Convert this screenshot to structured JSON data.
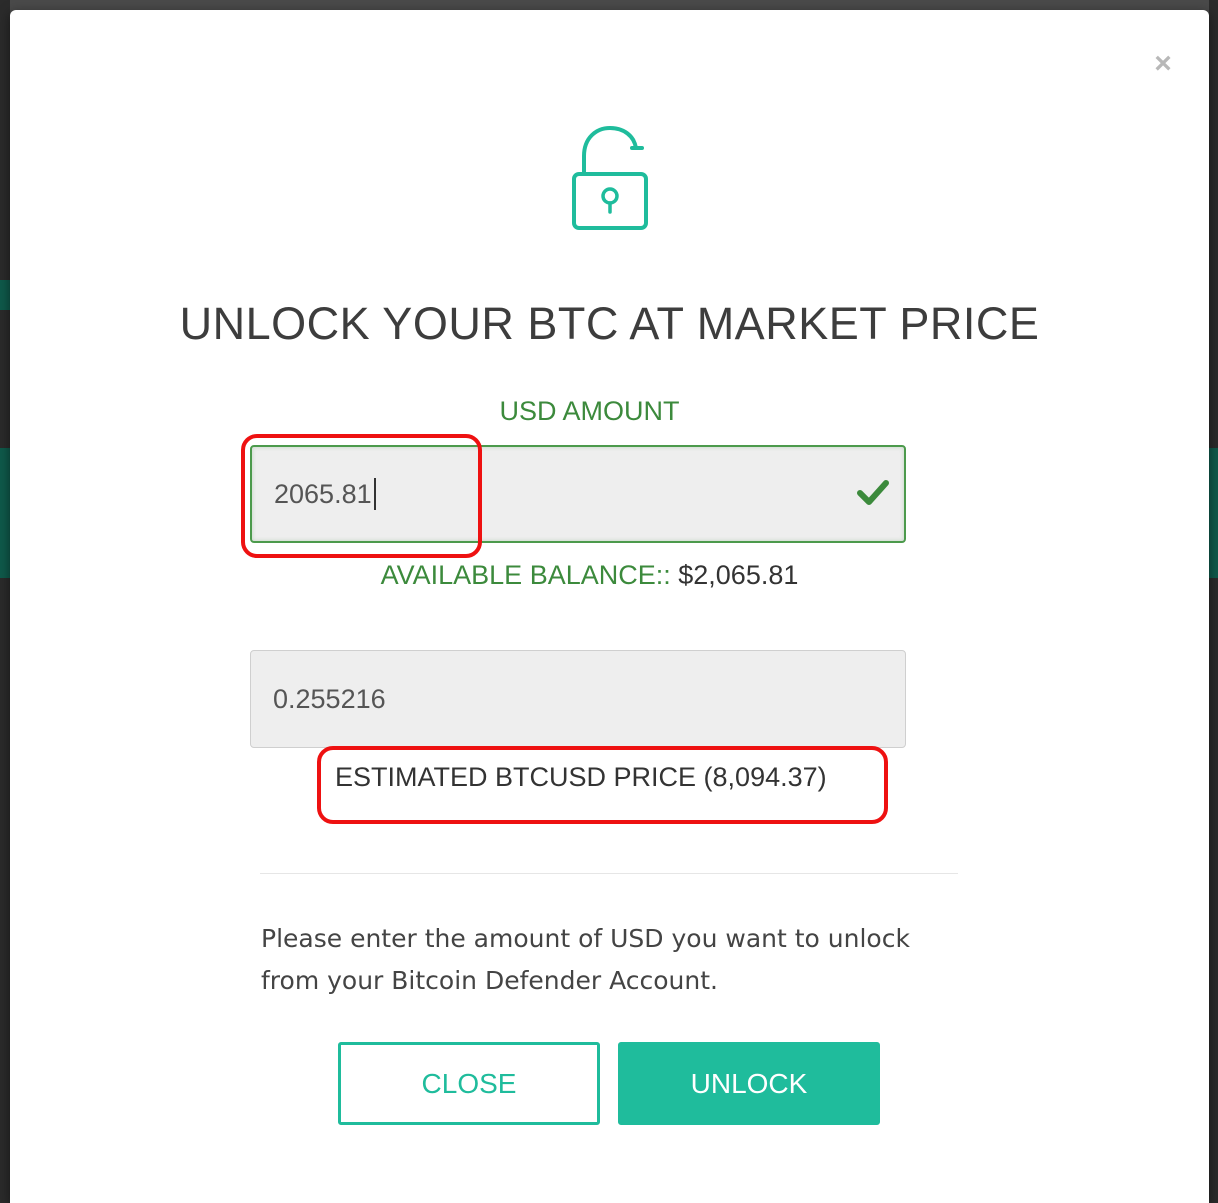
{
  "modal": {
    "close_glyph": "×",
    "title": "UNLOCK YOUR BTC AT MARKET PRICE",
    "usd_label": "USD AMOUNT",
    "usd_value": "2065.81",
    "balance_label": "AVAILABLE BALANCE:: ",
    "balance_amount": "$2,065.81",
    "btc_value": "0.255216",
    "estimate_label": "ESTIMATED BTCUSD PRICE (",
    "estimate_price": "8,094.37",
    "estimate_suffix": ")",
    "note": "Please enter the amount of USD you want to unlock from your Bitcoin Defender Account.",
    "close_button": "CLOSE",
    "unlock_button": "UNLOCK"
  },
  "icons": {
    "lock": "unlocked-padlock-icon",
    "check": "checkmark-icon",
    "close": "close-icon"
  },
  "colors": {
    "accent": "#1fbc9c",
    "valid": "#3c8a3c",
    "annotation": "#ee1111"
  }
}
